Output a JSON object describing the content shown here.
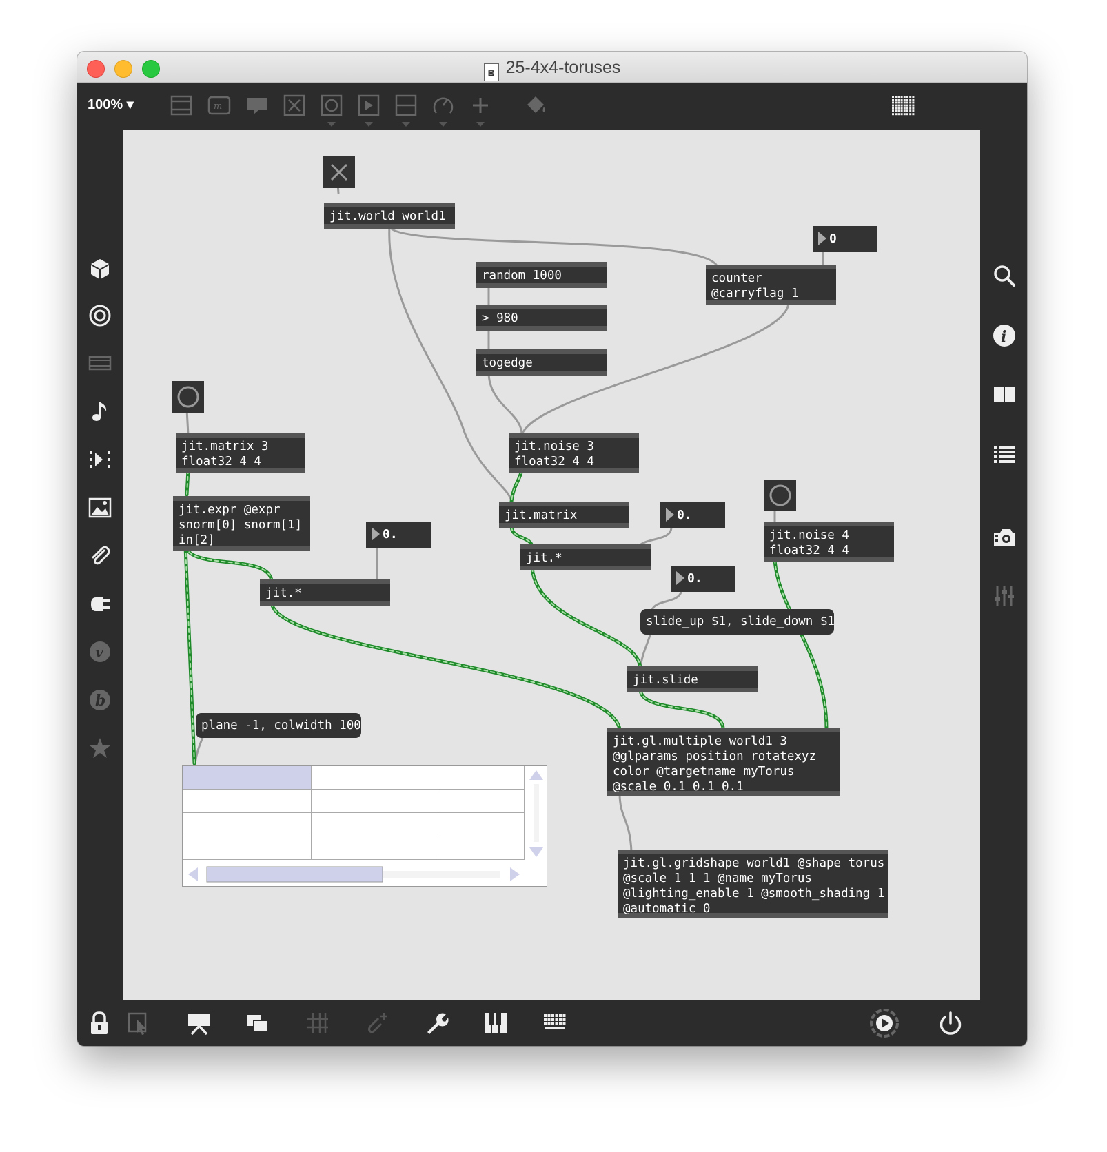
{
  "window": {
    "title": "25-4x4-toruses"
  },
  "toolbar": {
    "zoom_label": "100%",
    "icons": [
      "object-icon",
      "message-icon",
      "comment-icon",
      "toggle-icon",
      "button-icon",
      "play-icon",
      "slider-icon",
      "dial-icon",
      "add-icon",
      "paint-bucket-icon",
      "grid-icon"
    ]
  },
  "left_sidebar": {
    "icons": [
      "cube-icon",
      "target-icon",
      "media-icon",
      "music-note-icon",
      "step-icon",
      "image-icon",
      "paperclip-icon",
      "plug-icon",
      "v-icon",
      "b-icon",
      "star-icon"
    ]
  },
  "right_sidebar": {
    "icons": [
      "search-icon",
      "info-icon",
      "columns-icon",
      "list-icon",
      "camera-icon",
      "mixer-icon"
    ]
  },
  "patch": {
    "objects": {
      "jit_world": "jit.world world1",
      "random": "random 1000",
      "gt": "> 980",
      "togedge": "togedge",
      "counter": "counter\n@carryflag 1",
      "jit_matrix_3": "jit.matrix 3\nfloat32 4 4",
      "jit_expr": "jit.expr @expr\nsnorm[0] snorm[1]\nin[2]",
      "jit_noise_3": "jit.noise 3\nfloat32 4 4",
      "jit_matrix": "jit.matrix",
      "jit_mult_1": "jit.*",
      "jit_mult_2": "jit.*",
      "jit_noise_4": "jit.noise 4\nfloat32 4 4",
      "jit_slide": "jit.slide",
      "jit_gl_multiple": "jit.gl.multiple world1 3\n@glparams position rotatexyz\ncolor @targetname myTorus\n@scale 0.1 0.1 0.1",
      "jit_gl_gridshape": "jit.gl.gridshape world1 @shape torus\n@scale 1 1 1 @name myTorus\n@lighting_enable 1 @smooth_shading 1\n@automatic 0"
    },
    "messages": {
      "plane": "plane -1, colwidth 100",
      "slide": "slide_up $1, slide_down $1"
    },
    "numbers": {
      "counter_in": "0",
      "mult_a": "0.",
      "mult_b": "0.",
      "slide_val": "0."
    }
  },
  "bottom_bar": {
    "icons": [
      "lock-icon",
      "select-icon",
      "presentation-icon",
      "windows-icon",
      "grid-snap-icon",
      "clip-add-icon",
      "wrench-icon",
      "piano-icon",
      "keyboard-icon",
      "play-circle-icon",
      "power-icon"
    ]
  },
  "colors": {
    "canvas": "#e4e4e4",
    "object": "#333333",
    "matrix_cable": "#1f8a2a",
    "cable": "#9a9a9a"
  }
}
